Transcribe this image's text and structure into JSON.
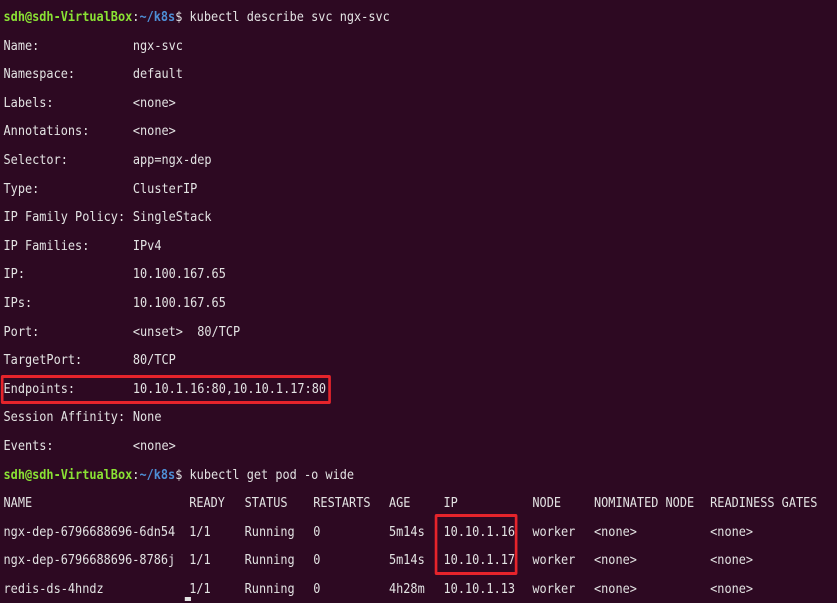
{
  "prompt1": {
    "user": "sdh@sdh-VirtualBox",
    "sep": ":",
    "path": "~/k8s",
    "dollar": "$ ",
    "command": "kubectl describe svc ngx-svc"
  },
  "describe": [
    {
      "key": "Name:",
      "value": "ngx-svc"
    },
    {
      "key": "Namespace:",
      "value": "default"
    },
    {
      "key": "Labels:",
      "value": "<none>"
    },
    {
      "key": "Annotations:",
      "value": "<none>"
    },
    {
      "key": "Selector:",
      "value": "app=ngx-dep"
    },
    {
      "key": "Type:",
      "value": "ClusterIP"
    },
    {
      "key": "IP Family Policy:",
      "value": "SingleStack"
    },
    {
      "key": "IP Families:",
      "value": "IPv4"
    },
    {
      "key": "IP:",
      "value": "10.100.167.65"
    },
    {
      "key": "IPs:",
      "value": "10.100.167.65"
    },
    {
      "key": "Port:",
      "value": "<unset>  80/TCP"
    },
    {
      "key": "TargetPort:",
      "value": "80/TCP"
    },
    {
      "key": "Endpoints:",
      "value": "10.10.1.16:80,10.10.1.17:80"
    },
    {
      "key": "Session Affinity:",
      "value": "None"
    },
    {
      "key": "Events:",
      "value": "<none>"
    }
  ],
  "prompt2": {
    "user": "sdh@sdh-VirtualBox",
    "sep": ":",
    "path": "~/k8s",
    "dollar": "$ ",
    "command": "kubectl get pod -o wide"
  },
  "pods": {
    "headers": [
      "NAME",
      "READY",
      "STATUS",
      "RESTARTS",
      "AGE",
      "IP",
      "NODE",
      "NOMINATED NODE",
      "READINESS GATES"
    ],
    "rows": [
      [
        "ngx-dep-6796688696-6dn54",
        "1/1",
        "Running",
        "0",
        "5m14s",
        "10.10.1.16",
        "worker",
        "<none>",
        "<none>"
      ],
      [
        "ngx-dep-6796688696-8786j",
        "1/1",
        "Running",
        "0",
        "5m14s",
        "10.10.1.17",
        "worker",
        "<none>",
        "<none>"
      ],
      [
        "redis-ds-4hndz",
        "1/1",
        "Running",
        "0",
        "4h28m",
        "10.10.1.13",
        "worker",
        "<none>",
        "<none>"
      ]
    ]
  },
  "colors": {
    "background": "#2d0922",
    "prompt_user": "#8ae234",
    "prompt_path": "#4e8fd6",
    "highlight": "#e5242b"
  }
}
